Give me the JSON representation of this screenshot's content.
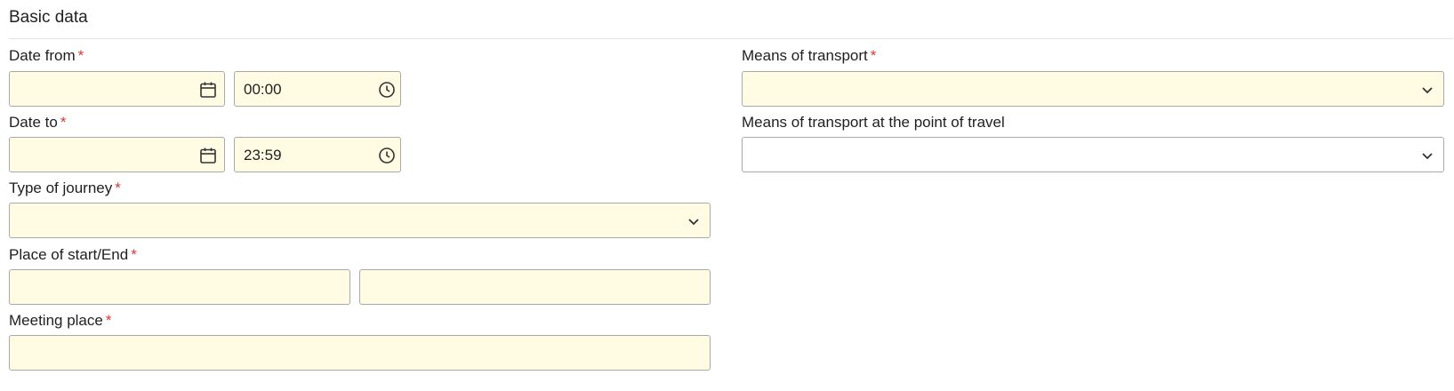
{
  "section": {
    "title": "Basic data"
  },
  "fields": {
    "date_from": {
      "label": "Date from",
      "required_mark": "*",
      "date_value": "",
      "time_value": "00:00"
    },
    "date_to": {
      "label": "Date to",
      "required_mark": "*",
      "date_value": "",
      "time_value": "23:59"
    },
    "type_of_journey": {
      "label": "Type of journey",
      "required_mark": "*",
      "selected": ""
    },
    "place_start_end": {
      "label": "Place of start/End",
      "required_mark": "*",
      "start_value": "",
      "end_value": ""
    },
    "meeting_place": {
      "label": "Meeting place",
      "required_mark": "*",
      "value": ""
    },
    "means_of_transport": {
      "label": "Means of transport",
      "required_mark": "*",
      "selected": ""
    },
    "means_of_transport_point": {
      "label": "Means of transport at the point of travel",
      "selected": ""
    }
  },
  "icons": {
    "date": "calendar-icon",
    "time": "clock-icon",
    "dropdown": "chevron-down-icon"
  },
  "colors": {
    "required_field_bg": "#fffce3",
    "required_mark": "#d43a3a",
    "border": "#a9a9a9"
  }
}
